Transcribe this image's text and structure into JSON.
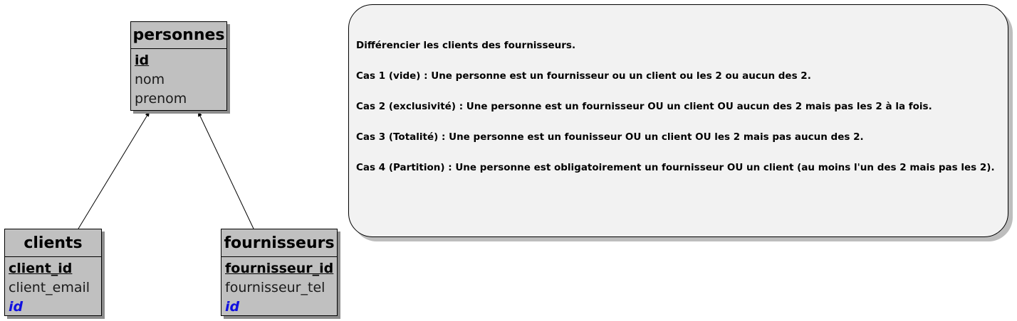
{
  "entities": {
    "personnes": {
      "name": "personnes",
      "attributes": [
        {
          "label": "id",
          "kind": "primary-key"
        },
        {
          "label": "nom",
          "kind": "plain"
        },
        {
          "label": "prenom",
          "kind": "plain"
        }
      ]
    },
    "clients": {
      "name": "clients",
      "attributes": [
        {
          "label": "client_id",
          "kind": "primary-key"
        },
        {
          "label": "client_email",
          "kind": "plain"
        },
        {
          "label": "id",
          "kind": "foreign-key"
        }
      ]
    },
    "fournisseurs": {
      "name": "fournisseurs",
      "attributes": [
        {
          "label": "fournisseur_id",
          "kind": "primary-key"
        },
        {
          "label": "fournisseur_tel",
          "kind": "plain"
        },
        {
          "label": "id",
          "kind": "foreign-key"
        }
      ]
    }
  },
  "relations": [
    {
      "from": "clients",
      "to": "personnes"
    },
    {
      "from": "fournisseurs",
      "to": "personnes"
    }
  ],
  "note": {
    "lines": [
      "Différencier les clients des fournisseurs.",
      "Cas 1 (vide) : Une personne est un fournisseur ou un client ou les 2 ou aucun des 2.",
      "Cas 2 (exclusivité) : Une personne est un fournisseur OU un client OU aucun des 2 mais pas les 2 à la fois.",
      "Cas 3 (Totalité) : Une personne est un founisseur OU un client OU les 2 mais pas aucun des 2.",
      "Cas 4 (Partition) : Une personne est obligatoirement  un fournisseur OU un client (au moins l'un des 2 mais pas les 2)."
    ]
  },
  "colors": {
    "entity_fill": "#c0c0c0",
    "entity_shadow": "#8c8c8c",
    "foreign_key_text": "#1010e0",
    "note_fill": "#f2f2f2",
    "line": "#000000"
  }
}
